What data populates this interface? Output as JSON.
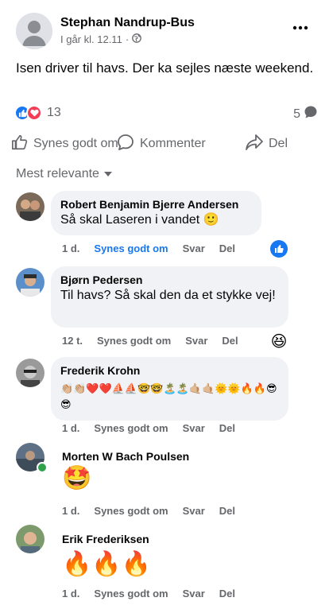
{
  "post": {
    "author": "Stephan Nandrup-Bus",
    "time": "I går kl. 12.11",
    "separator": "·",
    "text": "Isen driver til havs. Der ka sejles næste weekend.",
    "reaction_count": "13",
    "comment_count": "5"
  },
  "actions": {
    "like": "Synes godt om",
    "comment": "Kommenter",
    "share": "Del"
  },
  "sort_label": "Mest relevante",
  "comment_actions": {
    "like": "Synes godt om",
    "reply": "Svar",
    "share": "Del"
  },
  "comments": [
    {
      "name": "Robert Benjamin Bjerre Andersen",
      "text": "Så skal Laseren i vandet 🙂",
      "time": "1 d.",
      "reaction": "like"
    },
    {
      "name": "Bjørn Pedersen",
      "text": "Til havs? Så skal den da et stykke vej!",
      "time": "12 t.",
      "reaction": "haha"
    },
    {
      "name": "Frederik Krohn",
      "text": "👏🏼👏🏼❤️❤️⛵⛵🤓🤓🏝️🏝️🤙🏼🤙🏼🌞🌞🔥🔥😎😎",
      "time": "1 d."
    },
    {
      "name": "Morten W Bach Poulsen",
      "text": "🤩",
      "time": "1 d."
    },
    {
      "name": "Erik Frederiksen",
      "text": "🔥🔥🔥",
      "time": "1 d."
    }
  ],
  "colors": {
    "like_blue": "#1877f2",
    "love_red": "#f33e58",
    "muted": "#65676b",
    "bubble": "#f0f2f5"
  }
}
